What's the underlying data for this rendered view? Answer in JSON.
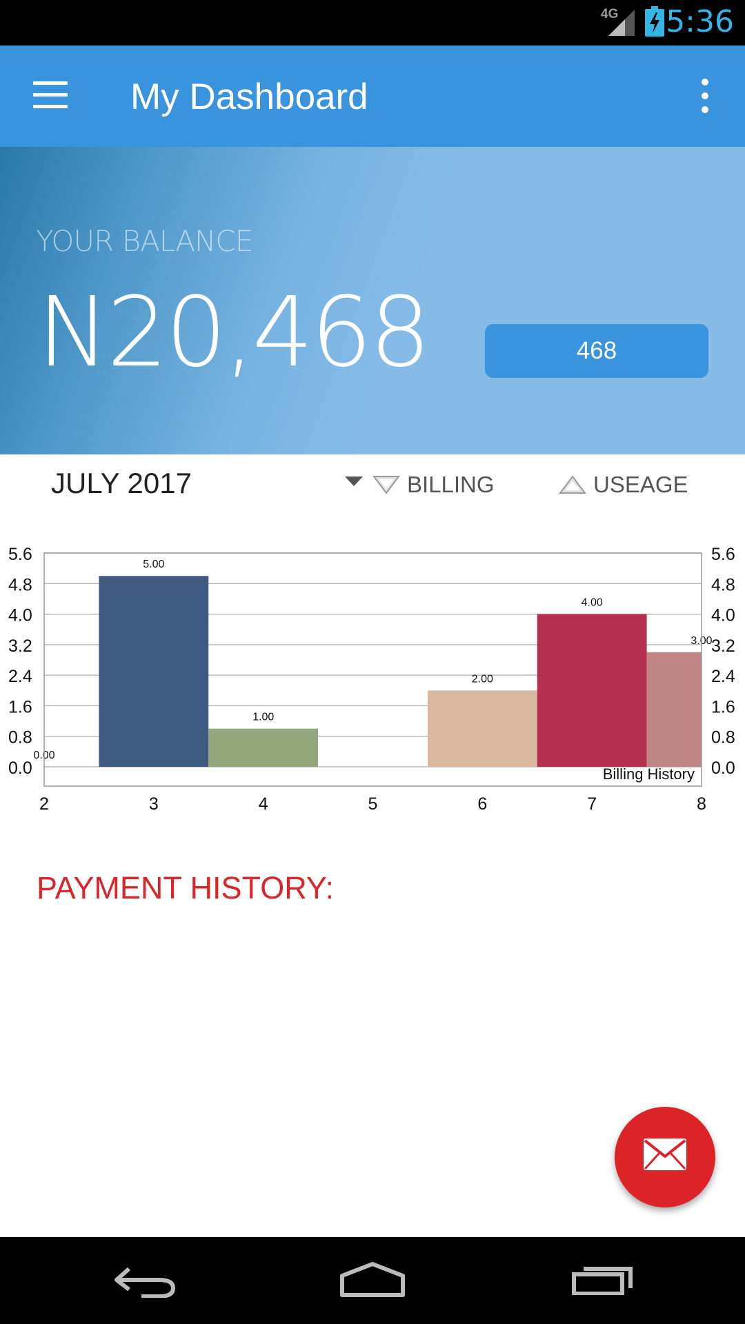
{
  "status_bar": {
    "time": "5:36",
    "network": "4G",
    "icons": [
      "signal-icon",
      "battery-charging-icon"
    ],
    "time_color": "#33b5e5"
  },
  "app_bar": {
    "title": "My Dashboard",
    "background": "#3a93dd",
    "icons": [
      "menu-icon",
      "overflow-menu-icon"
    ]
  },
  "balance": {
    "label": "YOUR BALANCE",
    "value": "N20,468",
    "button_label": "468"
  },
  "filter": {
    "month": "JULY 2017",
    "billing_label": "BILLING",
    "usage_label": "USEAGE",
    "icons": [
      "dropdown-caret-icon",
      "down-triangle-icon",
      "up-triangle-icon"
    ]
  },
  "chart_data": {
    "type": "bar",
    "x": [
      2,
      3,
      4,
      5,
      6,
      7,
      8
    ],
    "x_tick_labels": [
      "2",
      "3",
      "4",
      "5",
      "6",
      "7",
      "8"
    ],
    "y_tick_labels": [
      "5.6",
      "4.8",
      "4.0",
      "3.2",
      "2.4",
      "1.6",
      "0.8",
      "0.0"
    ],
    "ylim": [
      0,
      5.6
    ],
    "xlim": [
      2,
      8
    ],
    "grid": true,
    "bars": [
      {
        "x": 2,
        "value": 0.0,
        "label": "0.00",
        "color": "#3c5a85"
      },
      {
        "x": 3,
        "value": 5.0,
        "label": "5.00",
        "color": "#3f5a80"
      },
      {
        "x": 4,
        "value": 1.0,
        "label": "1.00",
        "color": "#94a67c"
      },
      {
        "x": 6,
        "value": 2.0,
        "label": "2.00",
        "color": "#d9b8a2"
      },
      {
        "x": 7,
        "value": 4.0,
        "label": "4.00",
        "color": "#b42f50"
      },
      {
        "x": 8,
        "value": 3.0,
        "label": "3.00",
        "color": "#c08585"
      }
    ],
    "legend": "Billing History",
    "legend_placement": "bottom-right"
  },
  "payment": {
    "title": "PAYMENT HISTORY:",
    "color": "#d9262b"
  },
  "fab": {
    "icon": "mail-icon",
    "color": "#dc2328"
  },
  "nav_bar": {
    "icons": [
      "back-icon",
      "home-icon",
      "recent-apps-icon"
    ]
  }
}
